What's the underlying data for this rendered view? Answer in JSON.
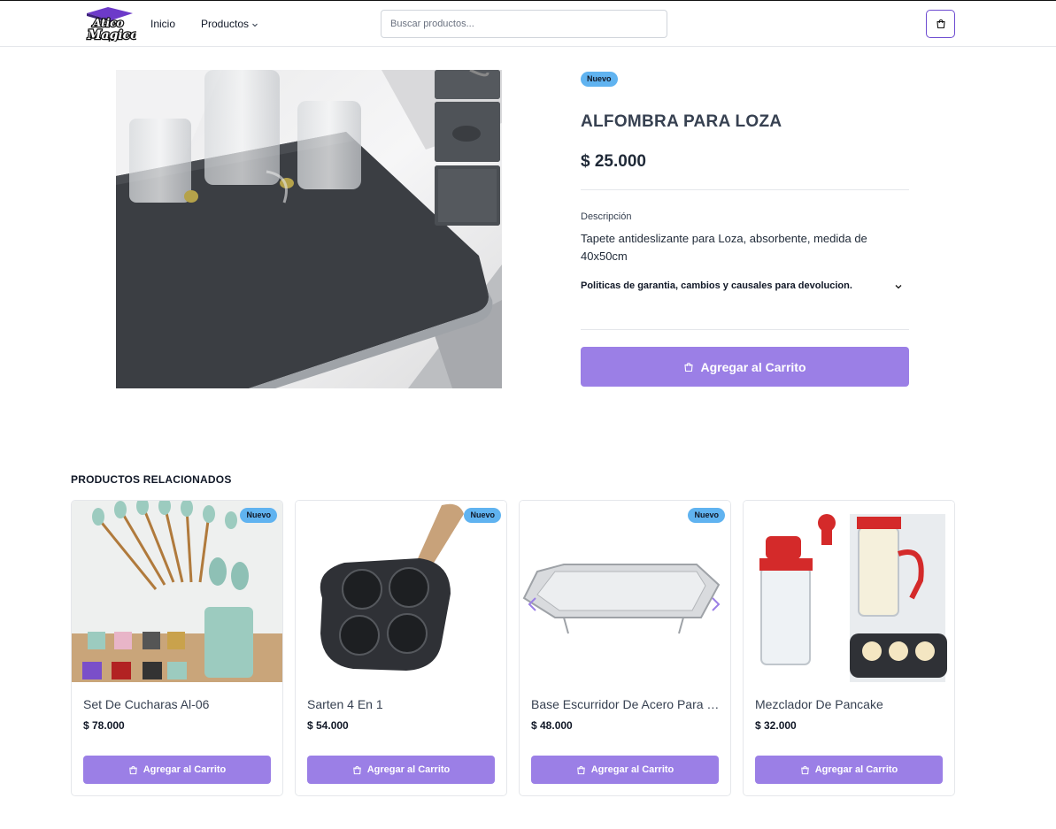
{
  "header": {
    "logo_text_top": "Atico",
    "logo_text_bottom": "Magico",
    "nav": {
      "inicio": "Inicio",
      "productos": "Productos"
    },
    "search_placeholder": "Buscar productos..."
  },
  "product": {
    "badge": "Nuevo",
    "title": "ALFOMBRA PARA LOZA",
    "price": "$ 25.000",
    "description_label": "Descripción",
    "description": "Tapete antideslizante para Loza, absorbente, medida de 40x50cm",
    "policy": "Politicas de garantia, cambios y causales para devolucion.",
    "add_to_cart": "Agregar al Carrito"
  },
  "related": {
    "title": "PRODUCTOS RELACIONADOS",
    "items": [
      {
        "name": "Set De Cucharas Al-06",
        "price": "$ 78.000",
        "badge": "Nuevo",
        "button": "Agregar al Carrito"
      },
      {
        "name": "Sarten 4 En 1",
        "price": "$ 54.000",
        "badge": "Nuevo",
        "button": "Agregar al Carrito"
      },
      {
        "name": "Base Escurridor De Acero Para Platos",
        "price": "$ 48.000",
        "badge": "Nuevo",
        "button": "Agregar al Carrito"
      },
      {
        "name": "Mezclador De Pancake",
        "price": "$ 32.000",
        "button": "Agregar al Carrito"
      }
    ]
  },
  "colors": {
    "accent": "#9b7fe6",
    "badge": "#60b3f0",
    "cart_border": "#6d4bd1"
  }
}
